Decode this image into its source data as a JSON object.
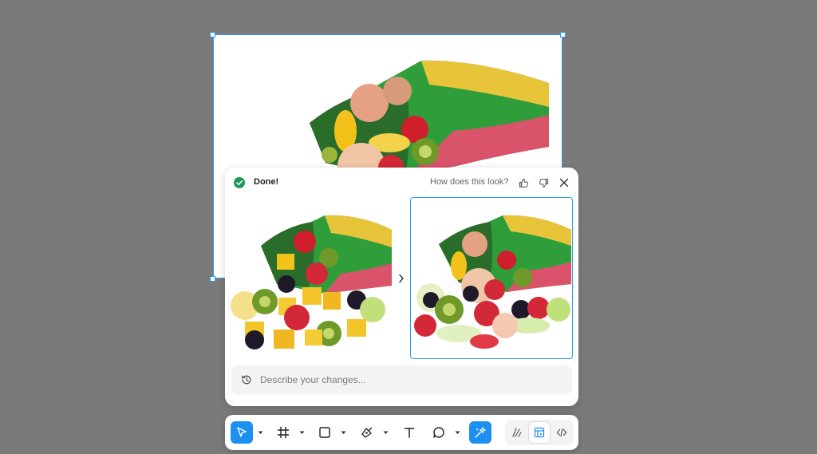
{
  "canvas": {
    "image_subject": "chip-bag-with-fruit"
  },
  "panel": {
    "status_label": "Done!",
    "feedback_prompt": "How does this look?",
    "thumbnails": [
      {
        "variant": "mango-kiwi-grapes",
        "selected": false
      },
      {
        "variant": "strawberry-kiwi-apple",
        "selected": true
      }
    ],
    "prompt_placeholder": "Describe your changes..."
  },
  "toolbar": {
    "tools": [
      {
        "icon": "cursor-icon",
        "active": true,
        "has_menu": true
      },
      {
        "icon": "frame-icon",
        "active": false,
        "has_menu": true
      },
      {
        "icon": "rectangle-icon",
        "active": false,
        "has_menu": true
      },
      {
        "icon": "pen-icon",
        "active": false,
        "has_menu": true
      },
      {
        "icon": "text-icon",
        "active": false,
        "has_menu": false
      },
      {
        "icon": "comment-icon",
        "active": false,
        "has_menu": true
      },
      {
        "icon": "ai-sparkle-icon",
        "active": true,
        "has_menu": false
      }
    ],
    "modes": [
      {
        "icon": "draw-mode-icon",
        "active": false
      },
      {
        "icon": "design-mode-icon",
        "active": true
      },
      {
        "icon": "dev-mode-icon",
        "active": false
      }
    ]
  },
  "colors": {
    "accent": "#1d8ff0",
    "selection": "#2a9bf0",
    "success": "#1b9b55",
    "canvas_bg": "#7a7a7a"
  }
}
